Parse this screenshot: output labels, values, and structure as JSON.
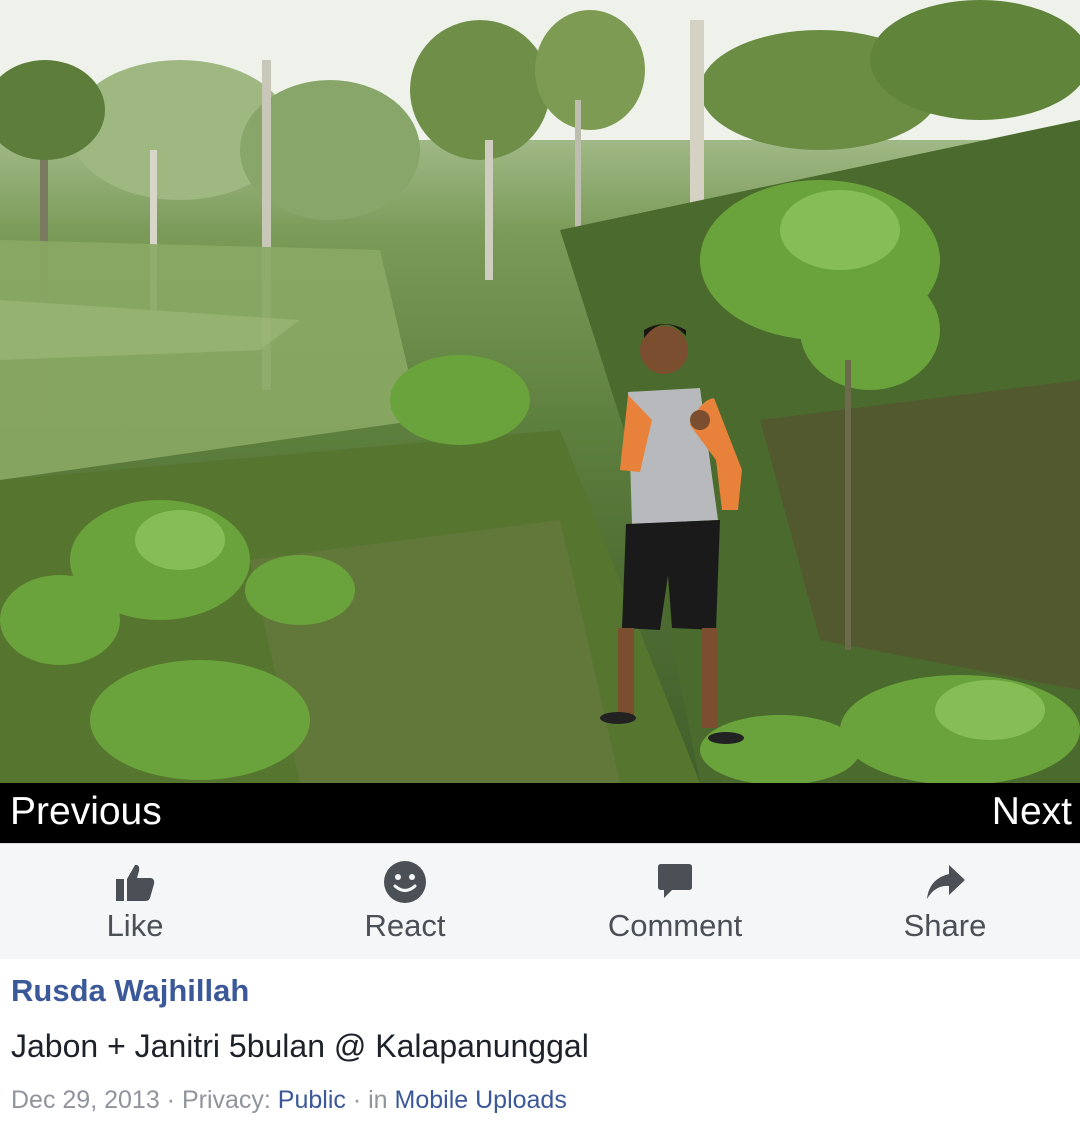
{
  "photo": {
    "alt": ""
  },
  "nav": {
    "previous_label": "Previous",
    "next_label": "Next"
  },
  "actions": [
    {
      "label": "Like",
      "icon": "thumbs-up-icon"
    },
    {
      "label": "React",
      "icon": "smiley-icon"
    },
    {
      "label": "Comment",
      "icon": "comment-bubble-icon"
    },
    {
      "label": "Share",
      "icon": "share-arrow-icon"
    }
  ],
  "post": {
    "author": "Rusda Wajhillah",
    "caption": "Jabon + Janitri 5bulan @ Kalapanunggal",
    "date": "Dec 29, 2013",
    "separator": " · ",
    "privacy_prefix": "Privacy: ",
    "privacy_value": "Public",
    "album_prefix": "in ",
    "album_name": "Mobile Uploads"
  },
  "colors": {
    "link": "#3b5998",
    "action_text": "#4b4f56",
    "action_icon": "#4b4f56",
    "meta_text": "#90949c",
    "action_bar_bg": "#f5f6f7",
    "nav_bg": "#000000"
  }
}
